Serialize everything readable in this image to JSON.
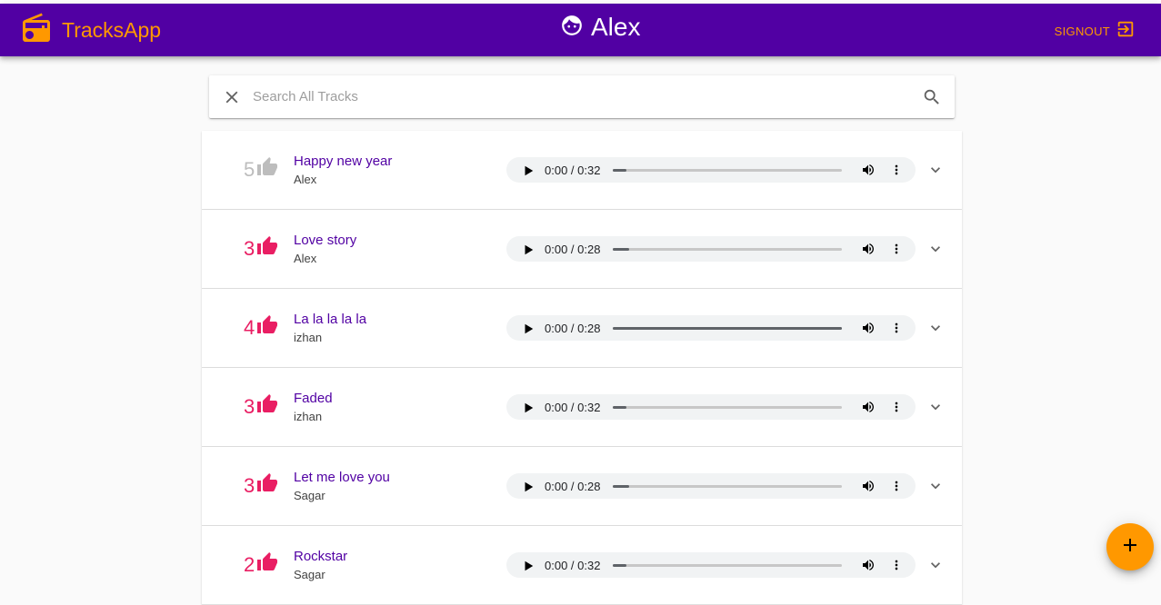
{
  "app": {
    "title": "TracksApp",
    "accent_color": "#ff9800",
    "bar_color": "#5100a3",
    "like_color": "#e91e63"
  },
  "header": {
    "user_name": "Alex",
    "signout_label": "SIGNOUT",
    "icons": {
      "brand": "radio-icon",
      "user": "face-icon",
      "signout": "exit-icon"
    }
  },
  "search": {
    "placeholder": "Search All Tracks",
    "value": ""
  },
  "tracks": [
    {
      "likes": "5",
      "title": "Happy new year",
      "artist": "Alex",
      "time": "0:00 / 0:32",
      "progress": 0.06,
      "liked": false
    },
    {
      "likes": "3",
      "title": "Love story",
      "artist": "Alex",
      "time": "0:00 / 0:28",
      "progress": 0.07,
      "liked": true
    },
    {
      "likes": "4",
      "title": "La la la la la",
      "artist": "izhan",
      "time": "0:00 / 0:28",
      "progress": 1.0,
      "liked": true
    },
    {
      "likes": "3",
      "title": "Faded",
      "artist": "izhan",
      "time": "0:00 / 0:32",
      "progress": 0.06,
      "liked": true
    },
    {
      "likes": "3",
      "title": "Let me love you",
      "artist": "Sagar",
      "time": "0:00 / 0:28",
      "progress": 0.07,
      "liked": true
    },
    {
      "likes": "2",
      "title": "Rockstar",
      "artist": "Sagar",
      "time": "0:00 / 0:32",
      "progress": 0.06,
      "liked": true
    }
  ],
  "fab": {
    "icon": "add-icon"
  }
}
